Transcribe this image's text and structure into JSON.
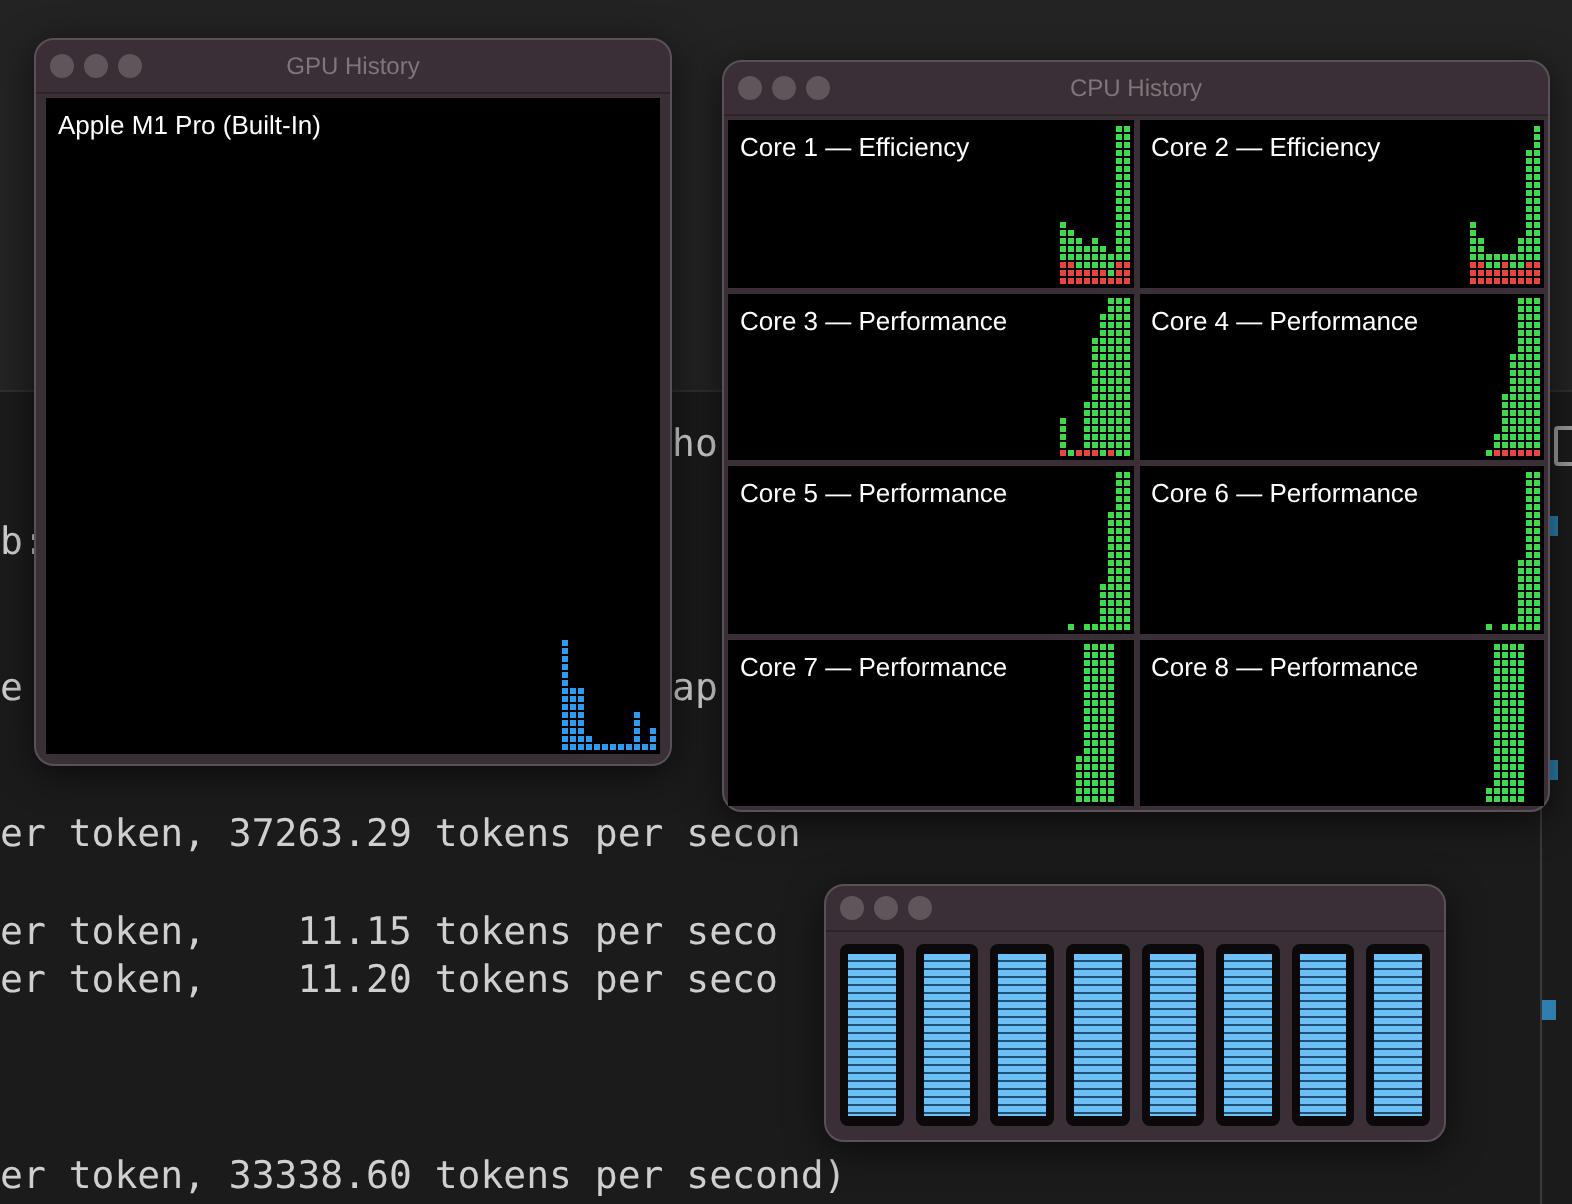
{
  "terminal": {
    "lines": [
      {
        "right": "ho"
      },
      {
        "left": "b:"
      },
      {
        "left": "e",
        "right": "ap"
      },
      {
        "left": "er token, 37263.29 tokens per secon"
      },
      {
        "left": "er token,    11.15 tokens per seco"
      },
      {
        "left": "er token,    11.20 tokens per seco"
      },
      {
        "left": "er token, 33338.60 tokens per second)"
      }
    ]
  },
  "gpu_window": {
    "title": "GPU History",
    "gpus": [
      {
        "name": "Apple M1 Pro (Built-In)"
      }
    ]
  },
  "cpu_window": {
    "title": "CPU History",
    "cores": [
      {
        "label": "Core 1 — Efficiency"
      },
      {
        "label": "Core 2 — Efficiency"
      },
      {
        "label": "Core 3 — Performance"
      },
      {
        "label": "Core 4 — Performance"
      },
      {
        "label": "Core 5 — Performance"
      },
      {
        "label": "Core 6 — Performance"
      },
      {
        "label": "Core 7 — Performance"
      },
      {
        "label": "Core 8 — Performance"
      }
    ]
  },
  "cpu_usage_window": {
    "meters": [
      {
        "level": 1
      },
      {
        "level": 1
      },
      {
        "level": 1
      },
      {
        "level": 1
      },
      {
        "level": 1
      },
      {
        "level": 1
      },
      {
        "level": 1
      },
      {
        "level": 1
      }
    ]
  }
}
